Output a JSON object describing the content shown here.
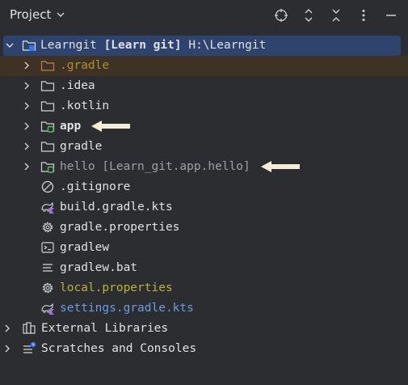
{
  "header": {
    "title": "Project",
    "icons": [
      "chevron-down-icon",
      "target-icon",
      "expand-all-icon",
      "collapse-all-icon",
      "more-icon",
      "minimize-icon"
    ]
  },
  "tree": {
    "root": {
      "name": "Learngit",
      "module": "[Learn git]",
      "path": "H:\\Learngit"
    },
    "items": [
      {
        "label": ".gradle",
        "type": "folder",
        "state": "excluded"
      },
      {
        "label": ".idea",
        "type": "folder"
      },
      {
        "label": ".kotlin",
        "type": "folder"
      },
      {
        "label": "app",
        "type": "module-folder"
      },
      {
        "label": "gradle",
        "type": "folder"
      },
      {
        "label": "hello",
        "module": "[Learn_git.app.hello]",
        "type": "module-folder"
      },
      {
        "label": ".gitignore",
        "type": "ignore-file"
      },
      {
        "label": "build.gradle.kts",
        "type": "gradle-kts"
      },
      {
        "label": "gradle.properties",
        "type": "properties"
      },
      {
        "label": "gradlew",
        "type": "terminal-script"
      },
      {
        "label": "gradlew.bat",
        "type": "text-file"
      },
      {
        "label": "local.properties",
        "type": "properties",
        "state": "ignored"
      },
      {
        "label": "settings.gradle.kts",
        "type": "gradle-kts",
        "state": "modified"
      }
    ],
    "external_libraries": "External Libraries",
    "scratches": "Scratches and Consoles"
  },
  "colors": {
    "background": "#2b2d30",
    "selection": "#2e436e",
    "excluded_row": "#3d3223",
    "arrow": "#f5ecd4"
  }
}
